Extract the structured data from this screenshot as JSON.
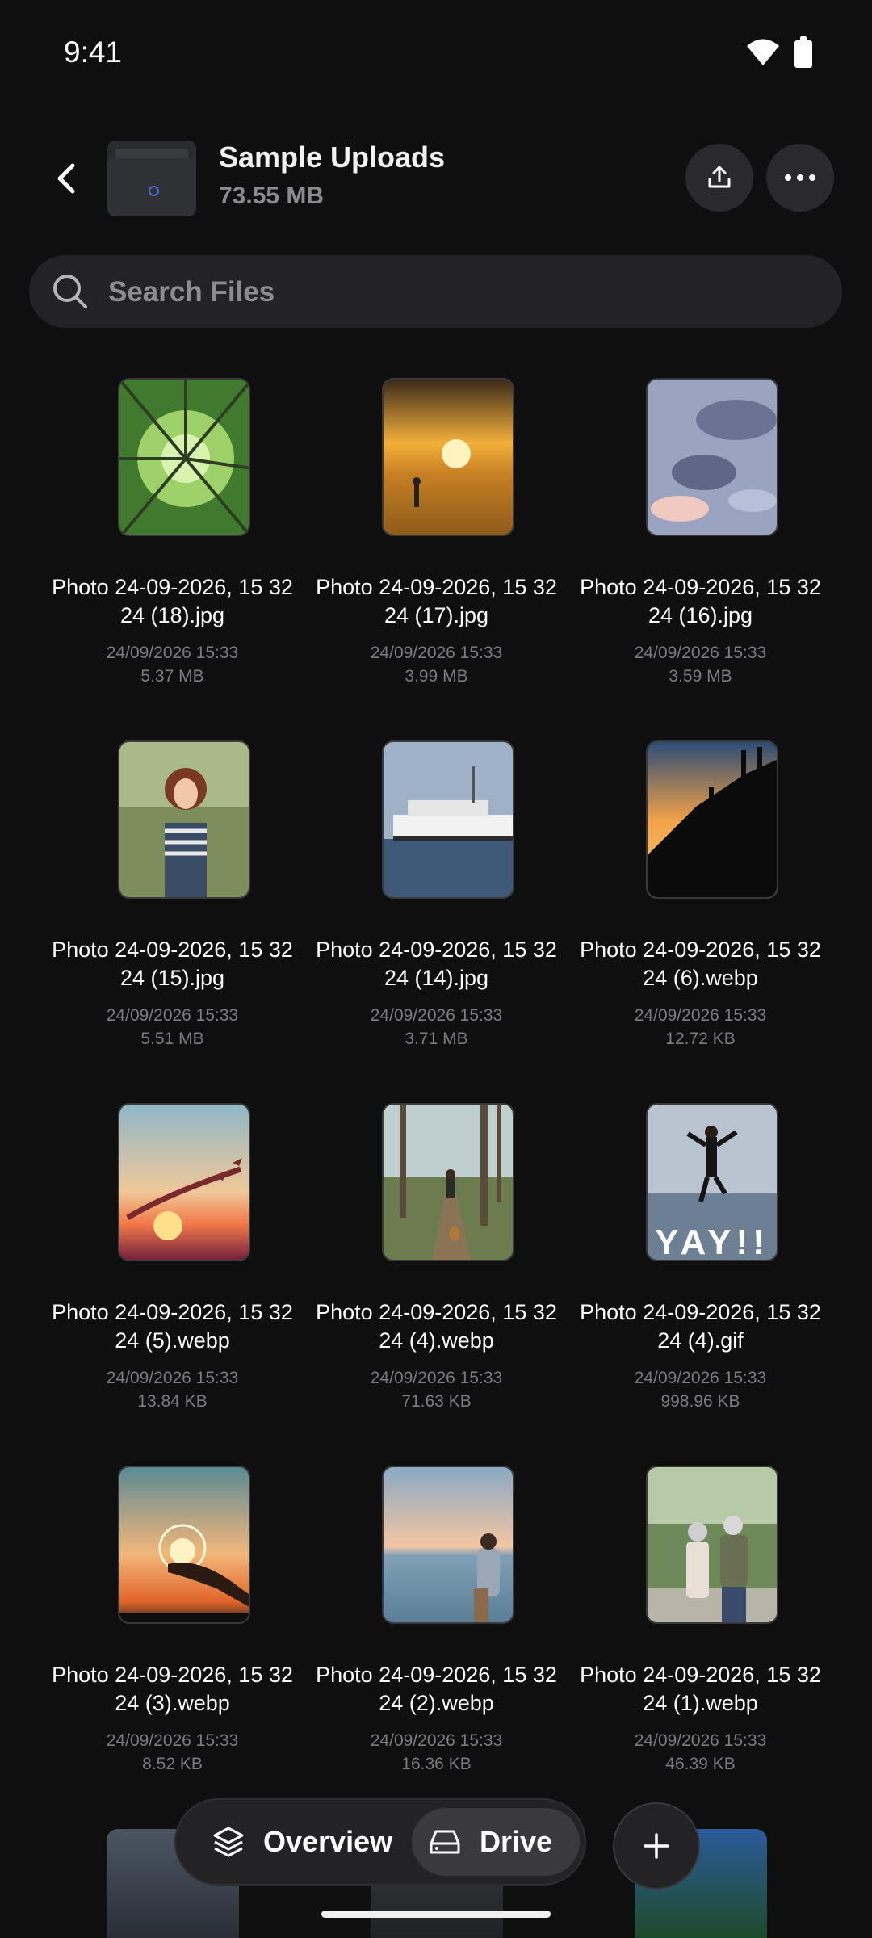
{
  "status_bar": {
    "time": "9:41"
  },
  "header": {
    "title": "Sample Uploads",
    "size": "73.55 MB"
  },
  "search": {
    "placeholder": "Search Files"
  },
  "files": [
    {
      "name": "Photo 24-09-2026, 15 32 24 (18).jpg",
      "date": "24/09/2026 15:33",
      "size": "5.37 MB",
      "thumb": "forest-canopy"
    },
    {
      "name": "Photo 24-09-2026, 15 32 24 (17).jpg",
      "date": "24/09/2026 15:33",
      "size": "3.99 MB",
      "thumb": "golden-field"
    },
    {
      "name": "Photo 24-09-2026, 15 32 24 (16).jpg",
      "date": "24/09/2026 15:33",
      "size": "3.59 MB",
      "thumb": "cloudy-sky"
    },
    {
      "name": "Photo 24-09-2026, 15 32 24 (15).jpg",
      "date": "24/09/2026 15:33",
      "size": "5.51 MB",
      "thumb": "woman-portrait"
    },
    {
      "name": "Photo 24-09-2026, 15 32 24 (14).jpg",
      "date": "24/09/2026 15:33",
      "size": "3.71 MB",
      "thumb": "ferry-boat"
    },
    {
      "name": "Photo 24-09-2026, 15 32 24 (6).webp",
      "date": "24/09/2026 15:33",
      "size": "12.72 KB",
      "thumb": "climbers-sunset"
    },
    {
      "name": "Photo 24-09-2026, 15 32 24 (5).webp",
      "date": "24/09/2026 15:33",
      "size": "13.84 KB",
      "thumb": "birds-sunset"
    },
    {
      "name": "Photo 24-09-2026, 15 32 24 (4).webp",
      "date": "24/09/2026 15:33",
      "size": "71.63 KB",
      "thumb": "forest-path"
    },
    {
      "name": "Photo 24-09-2026, 15 32 24 (4).gif",
      "date": "24/09/2026 15:33",
      "size": "998.96 KB",
      "thumb": "beach-yay",
      "overlay_text": "YAY!!"
    },
    {
      "name": "Photo 24-09-2026, 15 32 24 (3).webp",
      "date": "24/09/2026 15:33",
      "size": "8.52 KB",
      "thumb": "hand-sun"
    },
    {
      "name": "Photo 24-09-2026, 15 32 24 (2).webp",
      "date": "24/09/2026 15:33",
      "size": "16.36 KB",
      "thumb": "sea-woman"
    },
    {
      "name": "Photo 24-09-2026, 15 32 24 (1).webp",
      "date": "24/09/2026 15:33",
      "size": "46.39 KB",
      "thumb": "couple-walking"
    }
  ],
  "bottom_nav": {
    "overview_label": "Overview",
    "drive_label": "Drive",
    "active": "Drive"
  },
  "icons": [
    "back-arrow-icon",
    "upload-icon",
    "more-icon",
    "search-icon",
    "layers-icon",
    "drive-icon",
    "plus-icon",
    "wifi-icon",
    "battery-icon"
  ]
}
